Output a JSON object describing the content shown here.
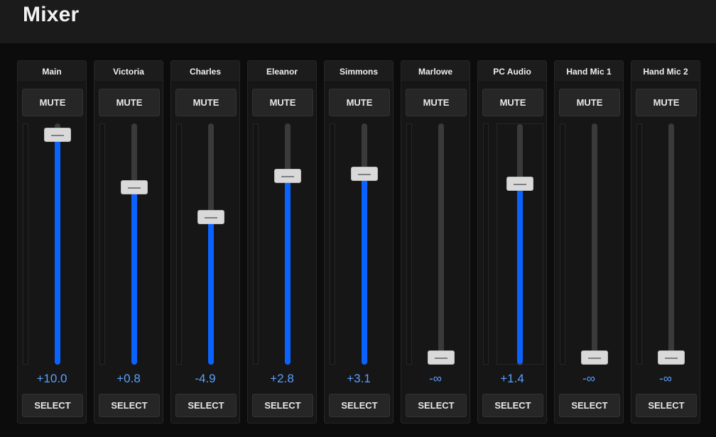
{
  "header": {
    "title": "Mixer"
  },
  "colors": {
    "accent": "#0a63ff",
    "value_text": "#5aa0ff"
  },
  "channels": [
    {
      "name": "Main",
      "mute_label": "MUTE",
      "select_label": "SELECT",
      "value": "+10.0",
      "level": 0.98
    },
    {
      "name": "Victoria",
      "mute_label": "MUTE",
      "select_label": "SELECT",
      "value": "+0.8",
      "level": 0.75
    },
    {
      "name": "Charles",
      "mute_label": "MUTE",
      "select_label": "SELECT",
      "value": "-4.9",
      "level": 0.62
    },
    {
      "name": "Eleanor",
      "mute_label": "MUTE",
      "select_label": "SELECT",
      "value": "+2.8",
      "level": 0.8
    },
    {
      "name": "Simmons",
      "mute_label": "MUTE",
      "select_label": "SELECT",
      "value": "+3.1",
      "level": 0.81
    },
    {
      "name": "Marlowe",
      "mute_label": "MUTE",
      "select_label": "SELECT",
      "value": "-∞",
      "level": 0.0
    },
    {
      "name": "PC Audio",
      "mute_label": "MUTE",
      "select_label": "SELECT",
      "value": "+1.4",
      "level": 0.77
    },
    {
      "name": "Hand Mic 1",
      "mute_label": "MUTE",
      "select_label": "SELECT",
      "value": "-∞",
      "level": 0.0
    },
    {
      "name": "Hand Mic 2",
      "mute_label": "MUTE",
      "select_label": "SELECT",
      "value": "-∞",
      "level": 0.0
    }
  ]
}
